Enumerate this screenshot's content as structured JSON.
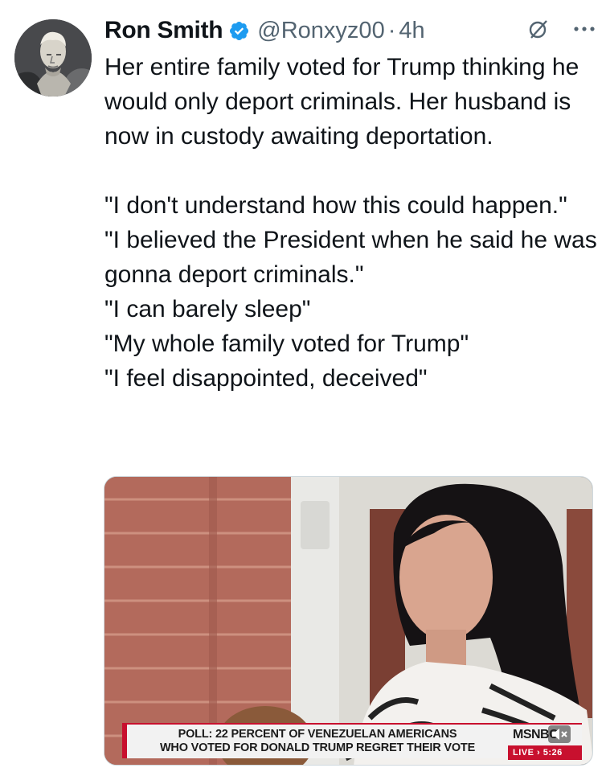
{
  "author": {
    "name": "Ron Smith",
    "handle": "@Ronxyz00",
    "separator": "·",
    "timestamp": "4h",
    "verified": true
  },
  "icons": {
    "avatar": "avatar-portrait",
    "verified": "verified-badge-icon",
    "grok": "grok-icon",
    "more": "more-icon",
    "mute": "mute-icon"
  },
  "colors": {
    "text": "#0f1419",
    "muted": "#536471",
    "verified": "#1d9bf0",
    "chyron_red": "#c8102e"
  },
  "tweet": {
    "paragraph_1": "Her entire family voted for Trump thinking he would only deport criminals. Her husband is now in custody awaiting deportation.",
    "quotes": [
      "\"I don't understand how this could happen.\"",
      "\"I believed the President when he said he was gonna deport criminals.\"",
      "\"I can barely sleep\"",
      "\"My whole family voted for Trump\"",
      "\"I feel disappointed, deceived\""
    ]
  },
  "media": {
    "chyron_line_1": "POLL: 22 PERCENT OF VENEZUELAN AMERICANS",
    "chyron_line_2": "WHO VOTED FOR DONALD TRUMP REGRET THEIR VOTE",
    "network": "MSNBC",
    "live_label": "LIVE › 5:26"
  }
}
